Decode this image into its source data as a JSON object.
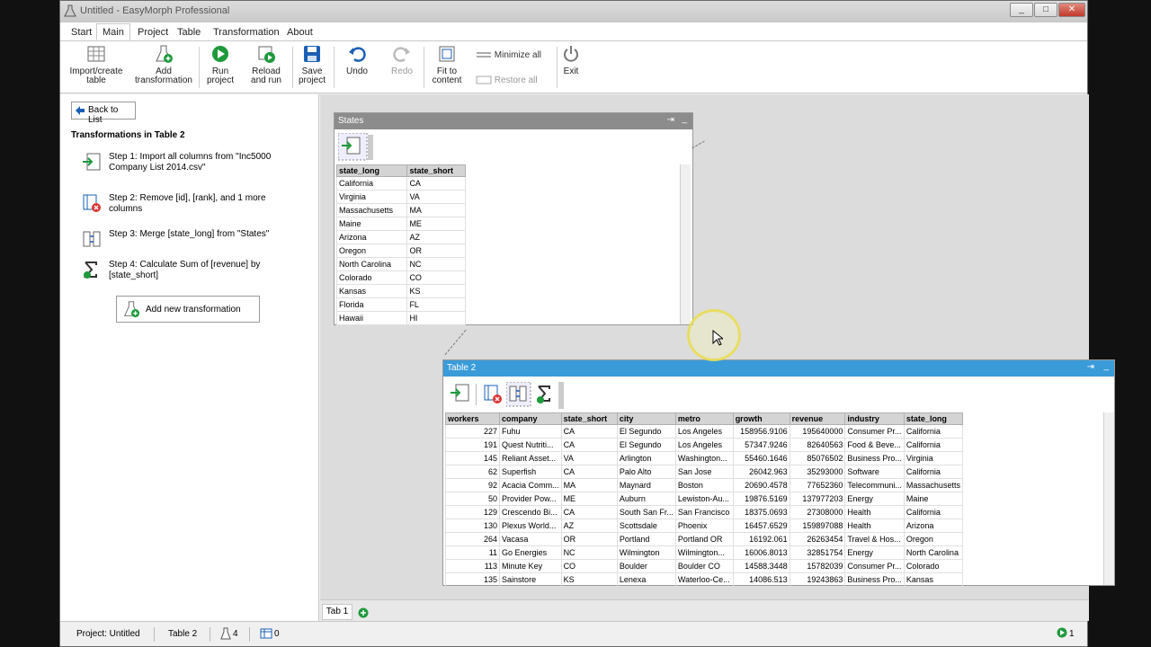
{
  "window": {
    "title": "Untitled - EasyMorph Professional"
  },
  "menu": {
    "tabs": [
      "Start",
      "Main",
      "Project",
      "Table",
      "Transformation",
      "About"
    ],
    "active": "Main"
  },
  "ribbon": {
    "import_create": "Import/create\ntable",
    "import_create_l1": "Import/create",
    "import_create_l2": "table",
    "add_trans_l1": "Add",
    "add_trans_l2": "transformation",
    "run_l1": "Run",
    "run_l2": "project",
    "reload_l1": "Reload",
    "reload_l2": "and run",
    "save_l1": "Save",
    "save_l2": "project",
    "undo": "Undo",
    "redo": "Redo",
    "fit_l1": "Fit to",
    "fit_l2": "content",
    "minimize_all": "Minimize all",
    "restore_all": "Restore all",
    "exit": "Exit"
  },
  "left_panel": {
    "back": "Back to List",
    "heading": "Transformations in Table 2",
    "steps": [
      {
        "text": "Step 1: Import all columns from \"Inc5000 Company List 2014.csv\""
      },
      {
        "text": "Step 2: Remove [id], [rank],  and 1 more columns"
      },
      {
        "text": "Step 3: Merge [state_long] from \"States\""
      },
      {
        "text": "Step 4: Calculate Sum of [revenue] by [state_short]"
      }
    ],
    "add_new": "Add new transformation"
  },
  "states_table": {
    "title": "States",
    "columns": [
      "state_long",
      "state_short"
    ],
    "rows": [
      [
        "California",
        "CA"
      ],
      [
        "Virginia",
        "VA"
      ],
      [
        "Massachusetts",
        "MA"
      ],
      [
        "Maine",
        "ME"
      ],
      [
        "Arizona",
        "AZ"
      ],
      [
        "Oregon",
        "OR"
      ],
      [
        "North Carolina",
        "NC"
      ],
      [
        "Colorado",
        "CO"
      ],
      [
        "Kansas",
        "KS"
      ],
      [
        "Florida",
        "FL"
      ],
      [
        "Hawaii",
        "HI"
      ]
    ]
  },
  "table2": {
    "title": "Table 2",
    "columns": [
      "workers",
      "company",
      "state_short",
      "city",
      "metro",
      "growth",
      "revenue",
      "industry",
      "state_long"
    ],
    "rows": [
      [
        "227",
        "Fuhu",
        "CA",
        "El Segundo",
        "Los Angeles",
        "158956.9106",
        "195640000",
        "Consumer Pr...",
        "California"
      ],
      [
        "191",
        "Quest Nutriti...",
        "CA",
        "El Segundo",
        "Los Angeles",
        "57347.9246",
        "82640563",
        "Food & Beve...",
        "California"
      ],
      [
        "145",
        "Reliant Asset...",
        "VA",
        "Arlington",
        "Washington...",
        "55460.1646",
        "85076502",
        "Business Pro...",
        "Virginia"
      ],
      [
        "62",
        "Superfish",
        "CA",
        "Palo Alto",
        "San Jose",
        "26042.963",
        "35293000",
        "Software",
        "California"
      ],
      [
        "92",
        "Acacia Comm...",
        "MA",
        "Maynard",
        "Boston",
        "20690.4578",
        "77652360",
        "Telecommuni...",
        "Massachusetts"
      ],
      [
        "50",
        "Provider Pow...",
        "ME",
        "Auburn",
        "Lewiston-Au...",
        "19876.5169",
        "137977203",
        "Energy",
        "Maine"
      ],
      [
        "129",
        "Crescendo Bi...",
        "CA",
        "South San Fr...",
        "San Francisco",
        "18375.0693",
        "27308000",
        "Health",
        "California"
      ],
      [
        "130",
        "Plexus World...",
        "AZ",
        "Scottsdale",
        "Phoenix",
        "16457.6529",
        "159897088",
        "Health",
        "Arizona"
      ],
      [
        "264",
        "Vacasa",
        "OR",
        "Portland",
        "Portland OR",
        "16192.061",
        "26263454",
        "Travel & Hos...",
        "Oregon"
      ],
      [
        "11",
        "Go Energies",
        "NC",
        "Wilmington",
        "Wilmington...",
        "16006.8013",
        "32851754",
        "Energy",
        "North Carolina"
      ],
      [
        "113",
        "Minute Key",
        "CO",
        "Boulder",
        "Boulder CO",
        "14588.3448",
        "15782039",
        "Consumer Pr...",
        "Colorado"
      ],
      [
        "135",
        "Sainstore",
        "KS",
        "Lenexa",
        "Waterloo-Ce...",
        "14086.513",
        "19243863",
        "Business Pro...",
        "Kansas"
      ]
    ]
  },
  "tabs_bottom": {
    "tab1": "Tab 1"
  },
  "status": {
    "project": "Project: Untitled",
    "table": "Table 2",
    "flask_count": "4",
    "table_count": "0",
    "run_count": "1"
  },
  "colors": {
    "active_header": "#3a9bd9",
    "inactive_header": "#8c8c8c",
    "accent_green": "#1e9a3c"
  }
}
